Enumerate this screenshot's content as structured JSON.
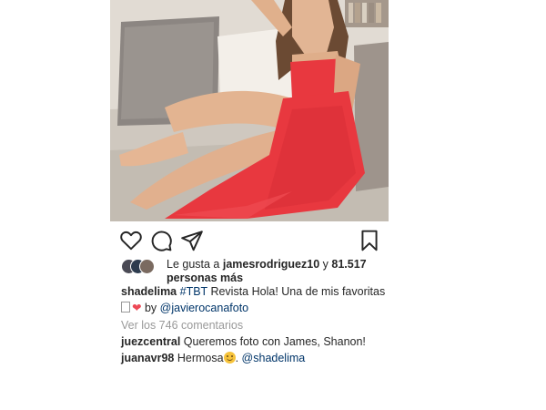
{
  "post": {
    "likes": {
      "prefix": "Le gusta a",
      "user": "jamesrodriguez10",
      "middle": "y",
      "count": "81.517",
      "suffix": "personas más"
    },
    "caption": {
      "user": "shadelima",
      "hashtag": "#TBT",
      "text": "Revista Hola! Una de mis favoritas",
      "by_text": "by",
      "mention": "@javierocanafoto"
    },
    "view_comments": "Ver los 746 comentarios",
    "comments": [
      {
        "user": "juezcentral",
        "text": "Queremos foto con James, Shanon!"
      },
      {
        "user": "juanavr98",
        "text": "Hermosa",
        "after_emoji": ".",
        "mention": "@shadelima"
      }
    ],
    "icons": {
      "like": "heart-icon",
      "comment": "comment-icon",
      "share": "share-icon",
      "save": "bookmark-icon"
    },
    "colors": {
      "link": "#003569",
      "muted": "#999999",
      "text": "#262626",
      "dress": "#e8383f"
    }
  }
}
